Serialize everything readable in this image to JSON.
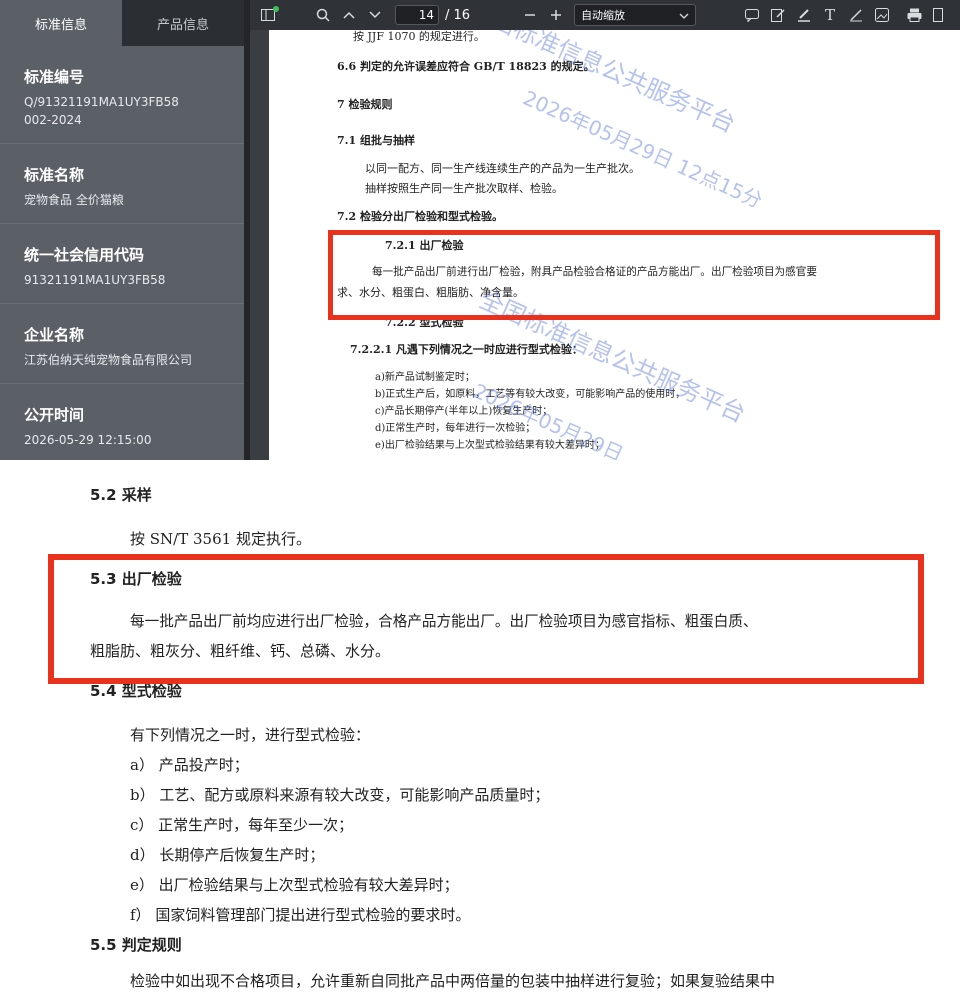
{
  "sidebar": {
    "tabs": [
      "标准信息",
      "产品信息"
    ],
    "fields": [
      {
        "title": "标准编号",
        "value": "Q/91321191MA1UY3FB58\n002-2024"
      },
      {
        "title": "标准名称",
        "value": "宠物食品 全价猫粮"
      },
      {
        "title": "统一社会信用代码",
        "value": "91321191MA1UY3FB58"
      },
      {
        "title": "企业名称",
        "value": "江苏伯纳天纯宠物食品有限公司"
      },
      {
        "title": "公开时间",
        "value": "2026-05-29 12:15:00"
      }
    ]
  },
  "toolbar": {
    "page_current": "14",
    "page_total": "/ 16",
    "zoom_label": "自动缩放",
    "icons": [
      "sidebar-toggle-icon",
      "search-icon",
      "chevron-up-icon",
      "chevron-down-icon",
      "zoom-out-icon",
      "zoom-in-icon",
      "comment-icon",
      "edit-icon",
      "highlight-icon",
      "text-icon",
      "draw-icon",
      "image-icon",
      "print-icon",
      "more-icon"
    ]
  },
  "pdf_page": {
    "lines": [
      "按 JJF 1070 的规定进行。",
      "6.6  判定的允许误差应符合 GB/T 18823 的规定。",
      "7  检验规则",
      "7.1  组批与抽样",
      "以同一配方、同一生产线连续生产的产品为一生产批次。",
      "抽样按照生产同一生产批次取样、检验。",
      "7.2  检验分出厂检验和型式检验。",
      "7.2.1  出厂检验",
      "每一批产品出厂前进行出厂检验，附具产品检验合格证的产品方能出厂。出厂检验项目为感官要",
      "求、水分、粗蛋白、粗脂肪、净含量。",
      "7.2.2  型式检验",
      "7.2.2.1  凡遇下列情况之一时应进行型式检验：",
      "a)新产品试制鉴定时；",
      "b)正式生产后，如原料，工艺等有较大改变，可能影响产品的使用时，",
      "c)产品长期停产(半年以上)恢复生产时；",
      "d)正常生产时，每年进行一次检验；",
      "e)出厂检验结果与上次型式检验结果有较大差异时；"
    ],
    "watermarks": [
      "全国标准信息公共服务平台",
      "2026年05月29日 12点15分",
      "全国标准信息公共服务平台",
      "2026年05月29日"
    ]
  },
  "lower_doc": {
    "s52_title": "5.2  采样",
    "s52_text": "按 SN/T 3561 规定执行。",
    "s53_title": "5.3  出厂检验",
    "s53_line1": "每一批产品出厂前均应进行出厂检验，合格产品方能出厂。出厂检验项目为感官指标、粗蛋白质、",
    "s53_line2": "粗脂肪、粗灰分、粗纤维、钙、总磷、水分。",
    "s54_title": "5.4  型式检验",
    "s54_intro": "有下列情况之一时，进行型式检验：",
    "s54_items": [
      "a）  产品投产时；",
      "b）  工艺、配方或原料来源有较大改变，可能影响产品质量时；",
      "c）  正常生产时，每年至少一次；",
      "d）  长期停产后恢复生产时；",
      "e）  出厂检验结果与上次型式检验有较大差异时；",
      "f）  国家饲料管理部门提出进行型式检验的要求时。"
    ],
    "s55_title": "5.5  判定规则",
    "s55_text": "检验中如出现不合格项目，允许重新自同批产品中两倍量的包装中抽样进行复验；如果复验结果中"
  },
  "colors": {
    "highlight_red": "#e8321e",
    "sidebar_bg": "#5b6066",
    "toolbar_bg": "#2f3236"
  }
}
